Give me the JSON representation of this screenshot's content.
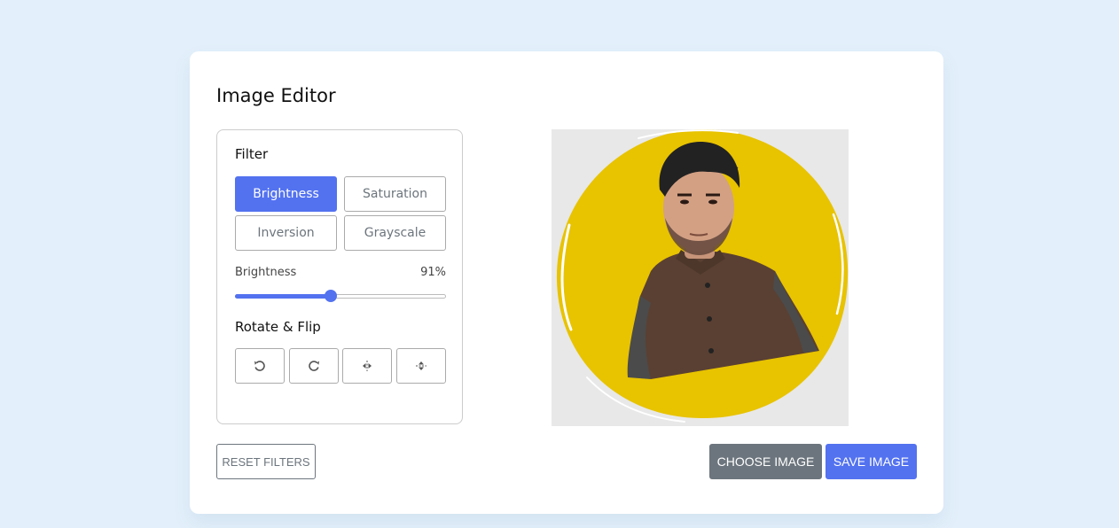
{
  "app": {
    "title": "Image Editor"
  },
  "filter": {
    "heading": "Filter",
    "options": [
      {
        "label": "Brightness",
        "active": true
      },
      {
        "label": "Saturation",
        "active": false
      },
      {
        "label": "Inversion",
        "active": false
      },
      {
        "label": "Grayscale",
        "active": false
      }
    ],
    "slider": {
      "name": "Brightness",
      "value_text": "91%",
      "level": 0.455
    }
  },
  "rotate": {
    "heading": "Rotate & Flip",
    "buttons": [
      {
        "icon": "rotate-left-icon"
      },
      {
        "icon": "rotate-right-icon"
      },
      {
        "icon": "flip-horizontal-icon"
      },
      {
        "icon": "flip-vertical-icon"
      }
    ]
  },
  "actions": {
    "reset_label": "RESET FILTERS",
    "choose_label": "CHOOSE IMAGE",
    "save_label": "SAVE IMAGE"
  },
  "colors": {
    "accent": "#5372f0",
    "secondary": "#6c757d",
    "page_background": "#e3f0fb",
    "preview_circle": "#e8c300"
  }
}
